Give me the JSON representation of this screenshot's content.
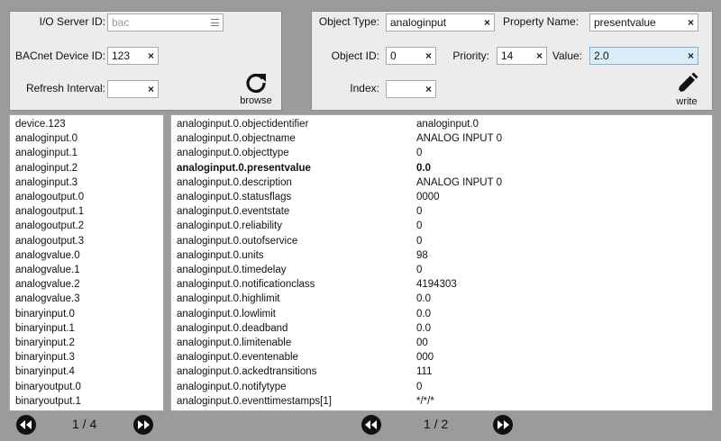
{
  "left_form": {
    "io_server_id": {
      "label": "I/O Server ID:",
      "value": "bac"
    },
    "bacnet_device_id": {
      "label": "BACnet Device ID:",
      "value": "123"
    },
    "refresh_interval": {
      "label": "Refresh Interval:",
      "value": ""
    },
    "browse_label": "browse"
  },
  "right_form": {
    "object_type": {
      "label": "Object Type:",
      "value": "analoginput"
    },
    "property_name": {
      "label": "Property Name:",
      "value": "presentvalue"
    },
    "object_id": {
      "label": "Object ID:",
      "value": "0"
    },
    "priority": {
      "label": "Priority:",
      "value": "14"
    },
    "value": {
      "label": "Value:",
      "value": "2.0"
    },
    "index": {
      "label": "Index:",
      "value": ""
    },
    "write_label": "write"
  },
  "objects": [
    "device.123",
    "analoginput.0",
    "analoginput.1",
    "analoginput.2",
    "analoginput.3",
    "analogoutput.0",
    "analogoutput.1",
    "analogoutput.2",
    "analogoutput.3",
    "analogvalue.0",
    "analogvalue.1",
    "analogvalue.2",
    "analogvalue.3",
    "binaryinput.0",
    "binaryinput.1",
    "binaryinput.2",
    "binaryinput.3",
    "binaryinput.4",
    "binaryoutput.0",
    "binaryoutput.1"
  ],
  "properties": [
    {
      "name": "analoginput.0.objectidentifier",
      "value": "analoginput.0"
    },
    {
      "name": "analoginput.0.objectname",
      "value": "ANALOG INPUT 0"
    },
    {
      "name": "analoginput.0.objecttype",
      "value": "0"
    },
    {
      "name": "analoginput.0.presentvalue",
      "value": "0.0",
      "selected": true
    },
    {
      "name": "analoginput.0.description",
      "value": "ANALOG INPUT 0"
    },
    {
      "name": "analoginput.0.statusflags",
      "value": "0000"
    },
    {
      "name": "analoginput.0.eventstate",
      "value": "0"
    },
    {
      "name": "analoginput.0.reliability",
      "value": "0"
    },
    {
      "name": "analoginput.0.outofservice",
      "value": "0"
    },
    {
      "name": "analoginput.0.units",
      "value": "98"
    },
    {
      "name": "analoginput.0.timedelay",
      "value": "0"
    },
    {
      "name": "analoginput.0.notificationclass",
      "value": "4194303"
    },
    {
      "name": "analoginput.0.highlimit",
      "value": "0.0"
    },
    {
      "name": "analoginput.0.lowlimit",
      "value": "0.0"
    },
    {
      "name": "analoginput.0.deadband",
      "value": "0.0"
    },
    {
      "name": "analoginput.0.limitenable",
      "value": "00"
    },
    {
      "name": "analoginput.0.eventenable",
      "value": "000"
    },
    {
      "name": "analoginput.0.ackedtransitions",
      "value": "111"
    },
    {
      "name": "analoginput.0.notifytype",
      "value": "0"
    },
    {
      "name": "analoginput.0.eventtimestamps[1]",
      "value": "*/*/*"
    }
  ],
  "left_pager": "1 / 4",
  "right_pager": "1 / 2",
  "icons": {
    "clear": "×",
    "browse": "refresh-icon",
    "write": "pencil-icon",
    "prev": "rewind-icon",
    "next": "fast-forward-icon"
  }
}
